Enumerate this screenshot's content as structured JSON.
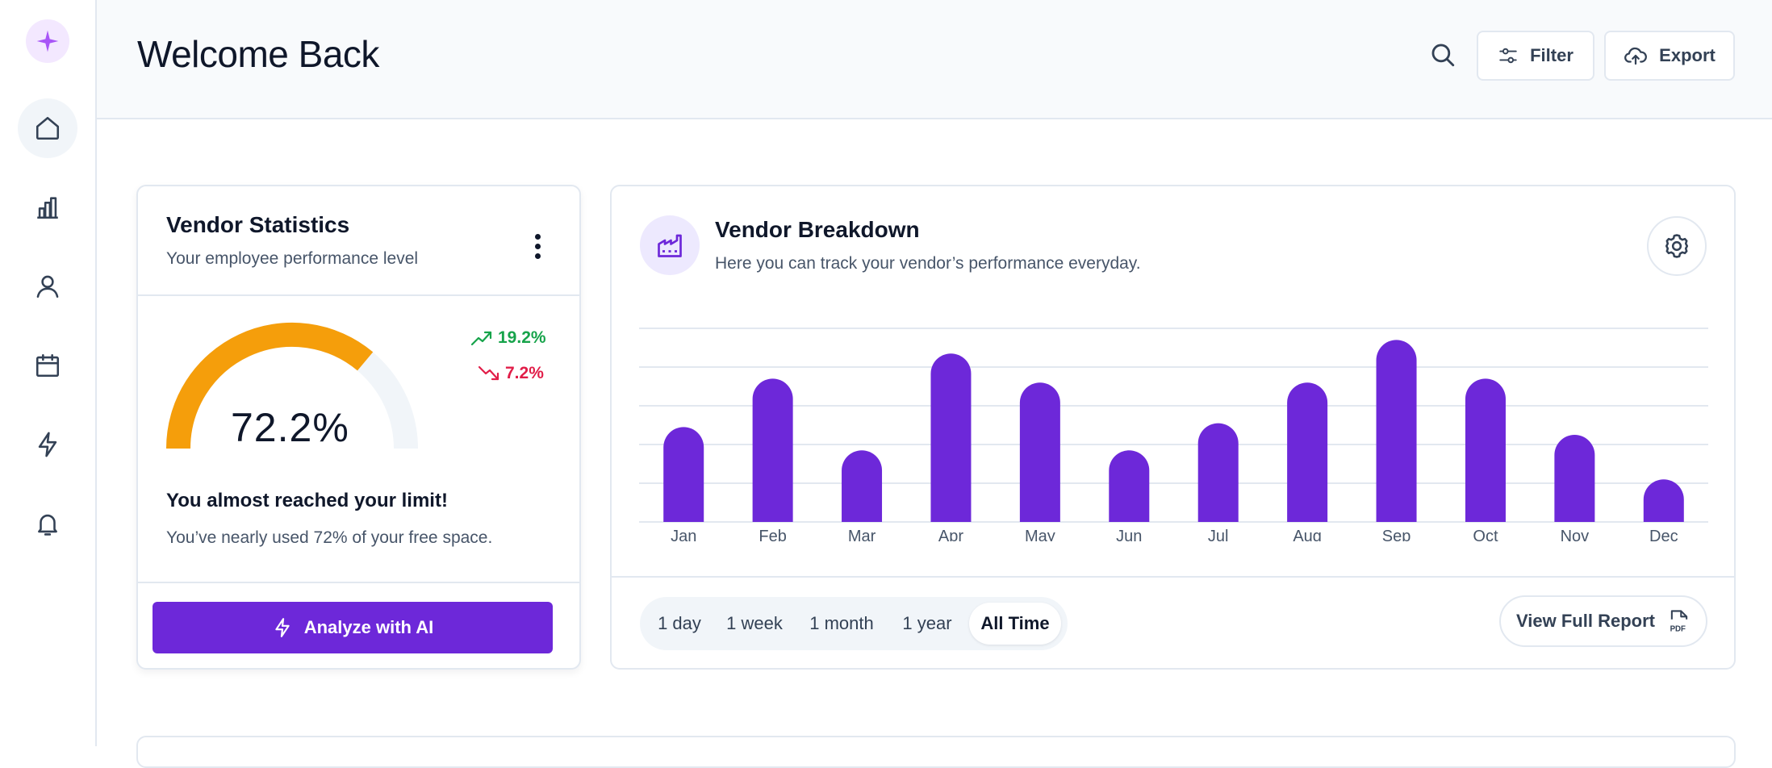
{
  "header": {
    "title": "Welcome Back",
    "filter_label": "Filter",
    "export_label": "Export"
  },
  "sidebar": {
    "items": [
      {
        "name": "home",
        "active": true
      },
      {
        "name": "analytics",
        "active": false
      },
      {
        "name": "users",
        "active": false
      },
      {
        "name": "calendar",
        "active": false
      },
      {
        "name": "automations",
        "active": false
      },
      {
        "name": "notifications",
        "active": false
      }
    ]
  },
  "vendor_stats": {
    "title": "Vendor Statistics",
    "subtitle": "Your employee performance level",
    "gauge_value": "72.2%",
    "gauge_fraction": 0.722,
    "trend_up": "19.2%",
    "trend_down": "7.2%",
    "limit_title": "You almost reached your limit!",
    "limit_text": "You’ve nearly used 72% of your free space.",
    "analyze_label": "Analyze with AI"
  },
  "vendor_breakdown": {
    "title": "Vendor Breakdown",
    "subtitle": "Here you can track your vendor’s performance everyday.",
    "ranges": [
      "1 day",
      "1 week",
      "1 month",
      "1 year",
      "All Time"
    ],
    "active_range": "All Time",
    "report_label": "View Full Report"
  },
  "chart_data": {
    "type": "bar",
    "categories": [
      "Jan",
      "Feb",
      "Mar",
      "Apr",
      "May",
      "Jun",
      "Jul",
      "Aug",
      "Sep",
      "Oct",
      "Nov",
      "Dec"
    ],
    "values": [
      49,
      74,
      37,
      87,
      72,
      37,
      51,
      72,
      94,
      74,
      45,
      22
    ],
    "ylim": [
      0,
      100
    ],
    "grid": true,
    "color": "#6d28d9"
  },
  "colors": {
    "accent": "#6d28d9",
    "gauge": "#f59e0b",
    "up": "#16a34a",
    "down": "#e11d48"
  }
}
